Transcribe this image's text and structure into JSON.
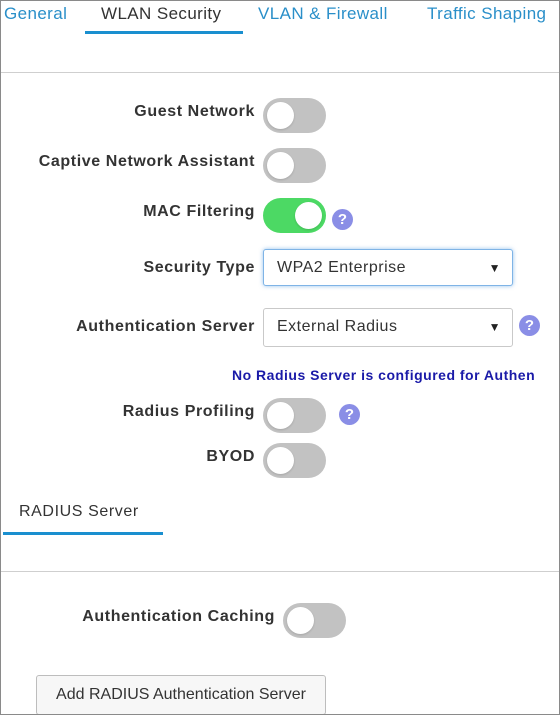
{
  "tabs": [
    {
      "label": "General",
      "active": false
    },
    {
      "label": "WLAN Security",
      "active": true
    },
    {
      "label": "VLAN & Firewall",
      "active": false
    },
    {
      "label": "Traffic Shaping",
      "active": false
    }
  ],
  "fields": {
    "guest_network": {
      "label": "Guest Network",
      "enabled": false
    },
    "captive_network_assistant": {
      "label": "Captive Network Assistant",
      "enabled": false
    },
    "mac_filtering": {
      "label": "MAC Filtering",
      "enabled": true,
      "help": "?"
    },
    "security_type": {
      "label": "Security Type",
      "value": "WPA2 Enterprise"
    },
    "authentication_server": {
      "label": "Authentication Server",
      "value": "External Radius",
      "help": "?"
    },
    "radius_notice": "No Radius Server is configured for Authen",
    "radius_profiling": {
      "label": "Radius Profiling",
      "enabled": false,
      "help": "?"
    },
    "byod": {
      "label": "BYOD",
      "enabled": false
    }
  },
  "subtab": {
    "label": "RADIUS Server"
  },
  "authentication_caching": {
    "label": "Authentication Caching",
    "enabled": false
  },
  "add_button": {
    "label": "Add RADIUS Authentication Server"
  },
  "colors": {
    "accent": "#1a8fcf",
    "toggle_on": "#4cd964",
    "toggle_off": "#c2c2c2",
    "help_icon": "#8a8ee6",
    "notice": "#1a1aa8"
  }
}
